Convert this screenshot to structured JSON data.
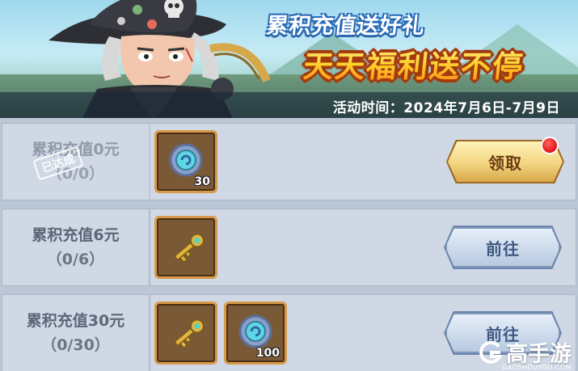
{
  "banner": {
    "title_line1": "累积充值送好礼",
    "title_line2": "天天福利送不停",
    "date_range": "活动时间：2024年7月6日-7月9日"
  },
  "rows": [
    {
      "label": "累积充值0元",
      "progress": "（0/0）",
      "stamp": "已达成",
      "rewards": [
        {
          "icon": "silver-coin-icon",
          "count": "30"
        }
      ],
      "button": "领取",
      "button_type": "claim",
      "has_red_dot": true
    },
    {
      "label": "累积充值6元",
      "progress": "（0/6）",
      "rewards": [
        {
          "icon": "golden-key-icon",
          "count": ""
        }
      ],
      "button": "前往",
      "button_type": "go"
    },
    {
      "label": "累积充值30元",
      "progress": "（0/30）",
      "rewards": [
        {
          "icon": "golden-key-icon",
          "count": ""
        },
        {
          "icon": "silver-coin-icon",
          "count": "100"
        }
      ],
      "button": "前往",
      "button_type": "go"
    }
  ],
  "watermark": {
    "text": "高手游",
    "sub": "GAOSHOUYOU.COM"
  },
  "colors": {
    "panel_bg": "#cfd8e4",
    "item_border": "#d79a4a",
    "claim_gold": "#f3d581",
    "go_blue": "#cad8ea"
  }
}
